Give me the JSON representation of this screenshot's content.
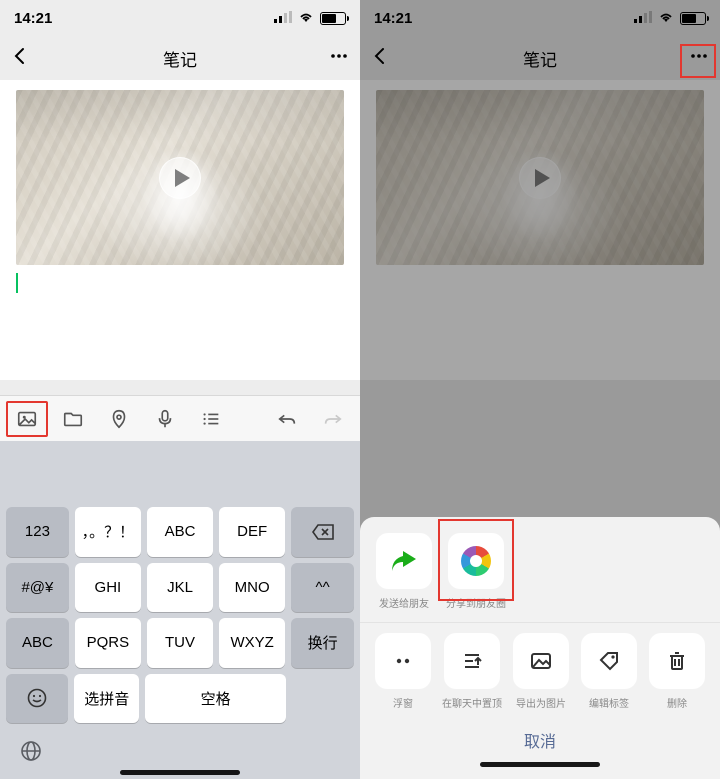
{
  "status": {
    "time": "14:21"
  },
  "nav": {
    "title": "笔记"
  },
  "toolbar_icons": [
    "image",
    "folder",
    "location",
    "mic",
    "list",
    "undo",
    "redo"
  ],
  "keyboard": {
    "row1": {
      "k0": "123",
      "k1": "，。？！",
      "k2": "ABC",
      "k3": "DEF"
    },
    "row2": {
      "k0": "#@¥",
      "k1": "GHI",
      "k2": "JKL",
      "k3": "MNO",
      "k4": "^^"
    },
    "row3": {
      "k0": "ABC",
      "k1": "PQRS",
      "k2": "TUV",
      "k3": "WXYZ"
    },
    "row4": {
      "k0": "选拼音",
      "k1": "空格",
      "kright": "换行"
    }
  },
  "share": {
    "row1": [
      {
        "id": "send-friend",
        "label": "发送给朋友"
      },
      {
        "id": "moments",
        "label": "分享到朋友圈"
      }
    ],
    "row2": [
      {
        "id": "float",
        "label": "浮窗"
      },
      {
        "id": "pin",
        "label": "在聊天中置顶"
      },
      {
        "id": "export",
        "label": "导出为图片"
      },
      {
        "id": "tags",
        "label": "编辑标签"
      },
      {
        "id": "delete",
        "label": "删除"
      }
    ],
    "cancel": "取消"
  }
}
